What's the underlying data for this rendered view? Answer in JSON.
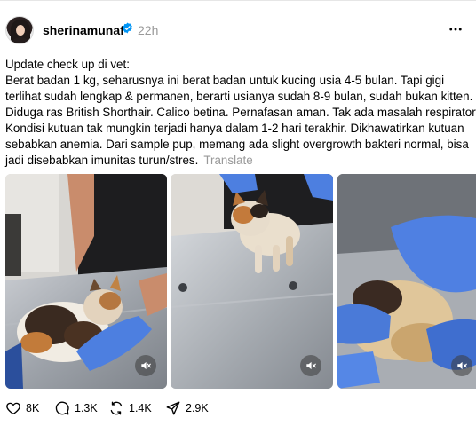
{
  "post": {
    "author": {
      "username": "sherinamunaf",
      "verified": true,
      "avatar_icon": "profile-photo"
    },
    "time": "22h",
    "text_lines": [
      "Update check up di vet:",
      "Berat badan 1 kg, seharusnya ini berat badan untuk kucing usia 4-5 bulan. Tapi gigi",
      "terlihat sudah lengkap & permanen, berarti usianya sudah 8-9 bulan, sudah bukan kitten.",
      "Diduga ras British Shorthair. Calico betina. Pernafasan aman. Tak ada masalah respiratory.",
      "Kondisi kutuan tak mungkin terjadi hanya dalam 1-2 hari terakhir. Dikhawatirkan kutuan",
      "sebabkan anemia. Dari sample pup, memang ada slight overgrowth bakteri normal, bisa",
      "jadi disebabkan imunitas turun/stres."
    ],
    "translate_label": "Translate",
    "media": [
      {
        "type": "video",
        "icon": "mute-icon"
      },
      {
        "type": "video",
        "icon": "mute-icon"
      },
      {
        "type": "video",
        "icon": "mute-icon"
      }
    ],
    "stats": {
      "likes": "8K",
      "replies": "1.3K",
      "reposts": "1.4K",
      "shares": "2.9K"
    }
  },
  "colors": {
    "verified": "#0095f6",
    "muted_text": "#999999",
    "glove_blue": "#4d7fe0"
  }
}
